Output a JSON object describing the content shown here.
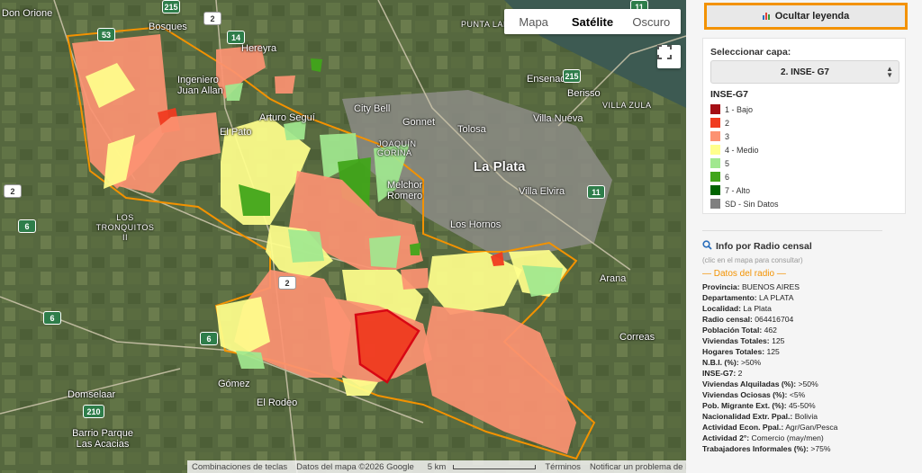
{
  "map": {
    "map_types": [
      "Mapa",
      "Satélite",
      "Oscuro"
    ],
    "active_map_type": "Satélite",
    "fullscreen_icon": "fullscreen-icon",
    "places": [
      {
        "name": "Don Orione",
        "style": "normal"
      },
      {
        "name": "Bosques",
        "style": "normal"
      },
      {
        "name": "Ingeniero Juan Allan",
        "style": "normal"
      },
      {
        "name": "Arturo Seguí",
        "style": "normal"
      },
      {
        "name": "City Bell",
        "style": "normal"
      },
      {
        "name": "Gonnet",
        "style": "normal"
      },
      {
        "name": "Ensenada",
        "style": "normal"
      },
      {
        "name": "Berisso",
        "style": "normal"
      },
      {
        "name": "Villa Nueva",
        "style": "normal"
      },
      {
        "name": "Tolosa",
        "style": "normal"
      },
      {
        "name": "La Plata",
        "style": "big"
      },
      {
        "name": "Villa Elvira",
        "style": "normal"
      },
      {
        "name": "Los Hornos",
        "style": "normal"
      },
      {
        "name": "Arana",
        "style": "normal"
      },
      {
        "name": "Correas",
        "style": "normal"
      },
      {
        "name": "Gómez",
        "style": "normal"
      },
      {
        "name": "El Rodeo",
        "style": "normal"
      },
      {
        "name": "Domselaar",
        "style": "normal"
      },
      {
        "name": "Barrio Parque Las Acacias",
        "style": "normal"
      },
      {
        "name": "LOS TRONQUITOS II",
        "style": "small"
      },
      {
        "name": "VILLA ZULA",
        "style": "small"
      },
      {
        "name": "JOAQUÍN GORINA",
        "style": "small"
      },
      {
        "name": "Melchor Romero",
        "style": "normal"
      },
      {
        "name": "El Pato",
        "style": "normal"
      },
      {
        "name": "Hereyra",
        "style": "normal"
      },
      {
        "name": "PUNTA LARA",
        "style": "small"
      }
    ],
    "road_shields": [
      "53",
      "2",
      "14",
      "2",
      "215",
      "11",
      "6",
      "6",
      "2",
      "210",
      "6",
      "215",
      "11"
    ],
    "attribution": {
      "shortcuts": "Combinaciones de teclas",
      "map_data": "Datos del mapa ©2026 Google",
      "scale": "5 km",
      "terms": "Términos",
      "report": "Notificar un problema de Maps"
    },
    "colors": {
      "bajo": "#a50f15",
      "c2": "#f03b20",
      "c3": "#fc9272",
      "medio": "#ffff8c",
      "c5": "#a1e88f",
      "c6": "#41a51a",
      "alto": "#006400",
      "sd": "#808080",
      "boundary": "#f39200",
      "selected": "#d7000f"
    }
  },
  "panel": {
    "hide_legend_label": "Ocultar leyenda",
    "hide_legend_icon": "bar-chart-icon",
    "select_layer_label": "Seleccionar capa:",
    "selected_layer": "2. INSE- G7",
    "legend_title": "INSE-G7",
    "legend": [
      {
        "label": "1 - Bajo",
        "color": "#a50f15"
      },
      {
        "label": "2",
        "color": "#f03b20"
      },
      {
        "label": "3",
        "color": "#fc9272"
      },
      {
        "label": "4 - Medio",
        "color": "#ffff8c"
      },
      {
        "label": "5",
        "color": "#a1e88f"
      },
      {
        "label": "6",
        "color": "#41a51a"
      },
      {
        "label": "7 - Alto",
        "color": "#006400"
      },
      {
        "label": "SD - Sin Datos",
        "color": "#808080"
      }
    ],
    "info_title": "Info por Radio censal",
    "info_icon": "search-icon",
    "info_hint": "(clic en el mapa para consultar)",
    "info_section": "— Datos del radio —",
    "info_rows": [
      {
        "label": "Provincia:",
        "value": "BUENOS AIRES"
      },
      {
        "label": "Departamento:",
        "value": "LA PLATA"
      },
      {
        "label": "Localidad:",
        "value": "La Plata"
      },
      {
        "label": "Radio censal:",
        "value": "064416704"
      },
      {
        "label": "Población Total:",
        "value": "462"
      },
      {
        "label": "Viviendas Totales:",
        "value": "125"
      },
      {
        "label": "Hogares Totales:",
        "value": "125"
      },
      {
        "label": "N.B.I. (%):",
        "value": ">50%"
      },
      {
        "label": "INSE-G7:",
        "value": "2"
      },
      {
        "label": "Viviendas Alquiladas (%):",
        "value": ">50%"
      },
      {
        "label": "Viviendas Ociosas (%):",
        "value": "<5%"
      },
      {
        "label": "Pob. Migrante Ext. (%):",
        "value": "45-50%"
      },
      {
        "label": "Nacionalidad Extr. Ppal.:",
        "value": "Bolivia"
      },
      {
        "label": "Actividad Econ. Ppal.:",
        "value": "Agr/Gan/Pesca"
      },
      {
        "label": "Actividad 2°:",
        "value": "Comercio (may/men)"
      },
      {
        "label": "Trabajadores Informales (%):",
        "value": ">75%"
      }
    ]
  }
}
